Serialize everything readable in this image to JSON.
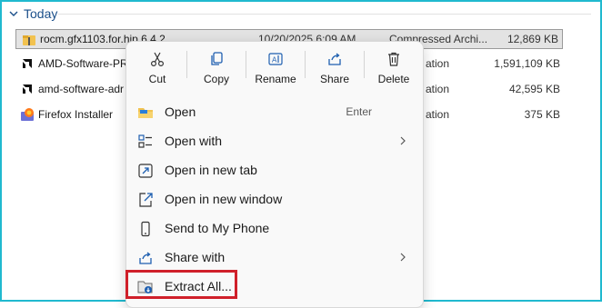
{
  "group": {
    "label": "Today"
  },
  "files": [
    {
      "name": "rocm.gfx1103.for.hip.6.4.2",
      "date": "10/20/2025 6:09 AM",
      "type": "Compressed Archi...",
      "size": "12,869 KB",
      "icon": "zip-folder-icon"
    },
    {
      "name": "AMD-Software-PR",
      "date": "",
      "type": "ation",
      "size": "1,591,109 KB",
      "icon": "amd-icon"
    },
    {
      "name": "amd-software-adr",
      "date": "",
      "type": "ation",
      "size": "42,595 KB",
      "icon": "amd-icon"
    },
    {
      "name": "Firefox Installer",
      "date": "",
      "type": "ation",
      "size": "375 KB",
      "icon": "firefox-icon"
    }
  ],
  "context_menu": {
    "toolbar": [
      {
        "label": "Cut",
        "icon": "scissors-icon"
      },
      {
        "label": "Copy",
        "icon": "copy-icon"
      },
      {
        "label": "Rename",
        "icon": "rename-icon"
      },
      {
        "label": "Share",
        "icon": "share-icon"
      },
      {
        "label": "Delete",
        "icon": "trash-icon"
      }
    ],
    "items": [
      {
        "label": "Open",
        "shortcut": "Enter",
        "icon": "folder-open-icon"
      },
      {
        "label": "Open with",
        "icon": "open-with-icon",
        "submenu": true
      },
      {
        "label": "Open in new tab",
        "icon": "new-tab-icon"
      },
      {
        "label": "Open in new window",
        "icon": "new-window-icon"
      },
      {
        "label": "Send to My Phone",
        "icon": "phone-icon"
      },
      {
        "label": "Share with",
        "icon": "share-with-icon",
        "submenu": true
      },
      {
        "label": "Extract All...",
        "icon": "extract-icon"
      }
    ]
  },
  "colors": {
    "frame": "#20b9cf",
    "highlight": "#d0202a",
    "group_header": "#1a4f8a"
  }
}
